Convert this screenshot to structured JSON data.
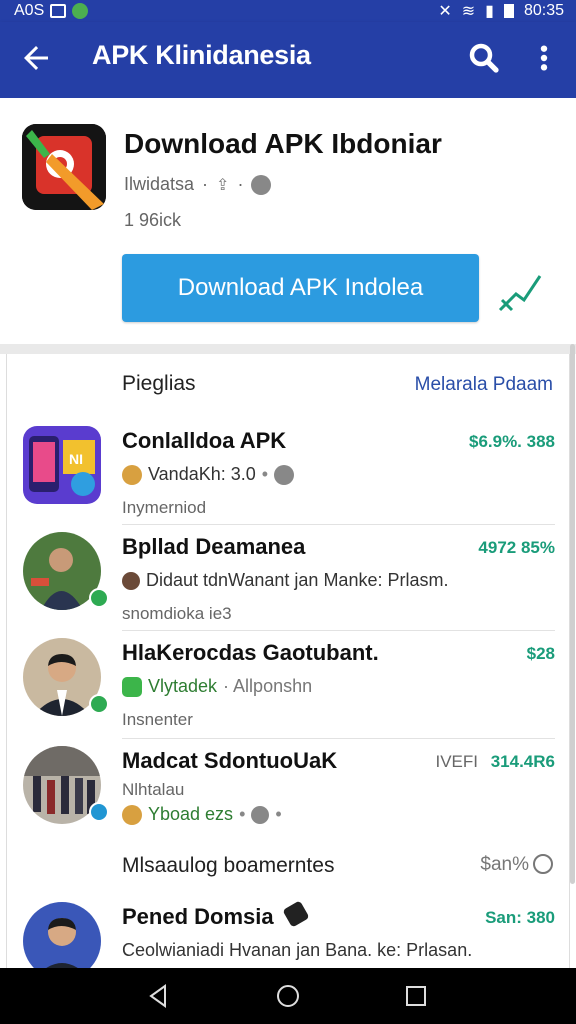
{
  "status_bar": {
    "carrier": "A0S",
    "time": "80:35"
  },
  "app_bar": {
    "title": "APK Klinidanesia",
    "icons": [
      "back-arrow-icon",
      "search-icon",
      "more-vert-icon"
    ]
  },
  "hero": {
    "app_title": "Download APK Ibdoniar",
    "developer": "Ilwidatsa",
    "downloads": "1 96ick",
    "download_button": "Download APK Indolea"
  },
  "list": {
    "section_title": "Pieglias",
    "section_link": "Melarala Pdaam",
    "items": [
      {
        "name": "Conlalldoa APK",
        "price": "$6.9%. 388",
        "sub": "VandaKh: 3.0",
        "tag": "Inymerniod"
      },
      {
        "name": "Bpllad Deamanea",
        "price": "4972 85%",
        "sub": "Didaut tdnWanant jan Manke: Prlasm.",
        "tag": "snomdioka ie3"
      },
      {
        "name": "HlaKerocdas Gaotubant.",
        "price": "$28",
        "sub_green": "Vlytadek",
        "sub_grey": "· Allponshn",
        "tag": "Insnenter"
      },
      {
        "name": "Madcat SdontuoUaK",
        "price_prefix": "IVEFI",
        "price": "314.4R6",
        "sub": "Nlhtalau",
        "sub2": "Yboad ezs"
      }
    ],
    "section2_title": "Mlsaaulog boamerntes",
    "section2_link": "$an%",
    "last_item": {
      "name": "Pened Domsia",
      "price": "San: 380",
      "sub": "Ceolwianiadi Hvanan jan Bana. ke: Prlasan."
    }
  },
  "colors": {
    "app_bar": "#253fa6",
    "button": "#2c9be0",
    "price": "#1a9c7a",
    "link": "#2a4ea8"
  }
}
